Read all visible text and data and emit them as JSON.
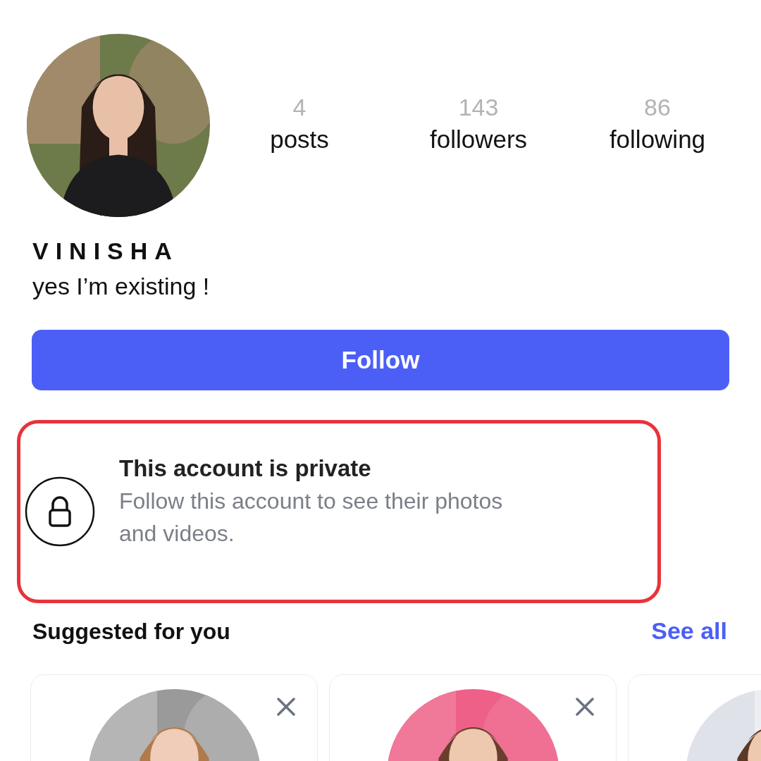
{
  "profile": {
    "stats": [
      {
        "value": "4",
        "label": "posts"
      },
      {
        "value": "143",
        "label": "followers"
      },
      {
        "value": "86",
        "label": "following"
      }
    ],
    "name": "VINISHA",
    "bio": "yes I’m existing !"
  },
  "follow_button": "Follow",
  "private_notice": {
    "title": "This account is private",
    "text": "Follow this account to see their photos and videos."
  },
  "suggested": {
    "title": "Suggested for you",
    "see_all": "See all",
    "cards": [
      {
        "kind": "picture",
        "dismissible": true
      },
      {
        "kind": "picture",
        "dismissible": true
      },
      {
        "kind": "picture"
      }
    ]
  }
}
